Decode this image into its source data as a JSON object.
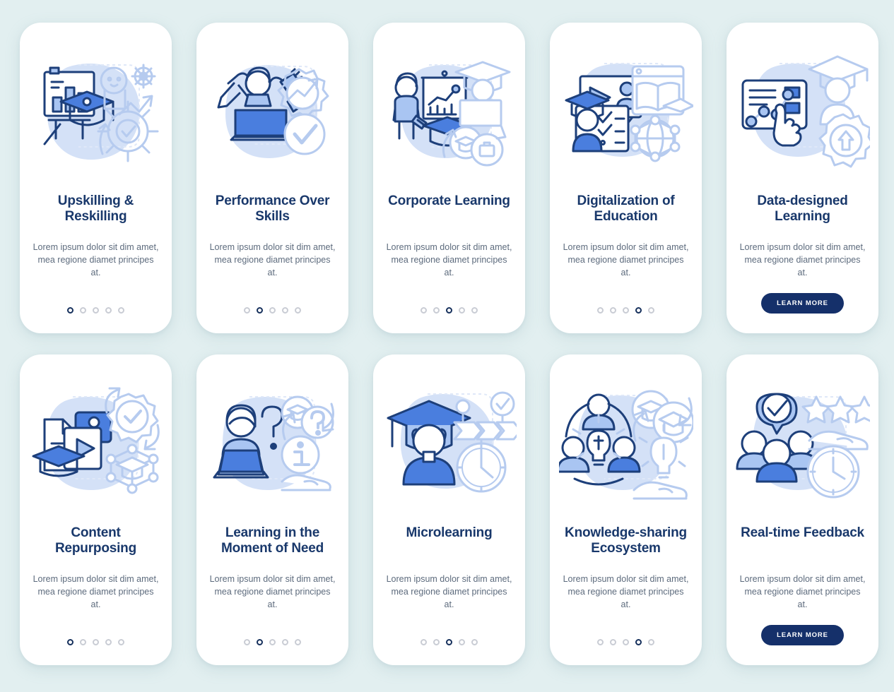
{
  "background_color": "#e2eff0",
  "card_color": "#ffffff",
  "title_color": "#19386b",
  "body_color": "#5d6b7d",
  "accent_color": "#15306a",
  "dot_active_color": "#16305c",
  "dot_inactive_color": "#c9ccd4",
  "shared": {
    "body_text": "Lorem ipsum dolor sit dim amet, mea regione diamet principes at.",
    "learn_more_label": "LEARN MORE",
    "dot_count": 5
  },
  "cards": [
    {
      "title": "Upskilling & Reskilling",
      "body_text": "Lorem ipsum dolor sit dim amet, mea regione diamet principes at.",
      "illustration": "presentation-board-graduation-cap-gear-person-icon",
      "footer_type": "dots",
      "active_dot": 1
    },
    {
      "title": "Performance Over Skills",
      "body_text": "Lorem ipsum dolor sit dim amet, mea regione diamet principes at.",
      "illustration": "multitasking-person-laptop-gear-chart-checkmark-icon",
      "footer_type": "dots",
      "active_dot": 2
    },
    {
      "title": "Corporate Learning",
      "body_text": "Lorem ipsum dolor sit dim amet, mea regione diamet principes at.",
      "illustration": "teacher-pointer-chart-board-graduate-briefcase-icon",
      "footer_type": "dots",
      "active_dot": 3
    },
    {
      "title": "Digitalization of Education",
      "body_text": "Lorem ipsum dolor sit dim amet, mea regione diamet principes at.",
      "illustration": "video-player-checklist-graduate-book-network-icon",
      "footer_type": "dots",
      "active_dot": 4
    },
    {
      "title": "Data-designed Learning",
      "body_text": "Lorem ipsum dolor sit dim amet, mea regione diamet principes at.",
      "illustration": "data-dashboard-hand-pointer-graduate-gear-arrow-icon",
      "footer_type": "button",
      "active_dot": 0
    },
    {
      "title": "Content Repurposing",
      "body_text": "Lorem ipsum dolor sit dim amet, mea regione diamet principes at.",
      "illustration": "documents-video-graduation-cap-gear-check-network-icon",
      "footer_type": "dots",
      "active_dot": 1
    },
    {
      "title": "Learning in the Moment of Need",
      "body_text": "Lorem ipsum dolor sit dim amet, mea regione diamet principes at.",
      "illustration": "person-laptop-question-mark-info-hand-icon",
      "footer_type": "dots",
      "active_dot": 2
    },
    {
      "title": "Microlearning",
      "body_text": "Lorem ipsum dolor sit dim amet, mea regione diamet principes at.",
      "illustration": "graduate-cap-process-arrows-clock-icon",
      "footer_type": "dots",
      "active_dot": 3
    },
    {
      "title": "Knowledge-sharing Ecosystem",
      "body_text": "Lorem ipsum dolor sit dim amet, mea regione diamet principes at.",
      "illustration": "people-lightbulb-graduation-caps-hand-icon",
      "footer_type": "dots",
      "active_dot": 4
    },
    {
      "title": "Real-time Feedback",
      "body_text": "Lorem ipsum dolor sit dim amet, mea regione diamet principes at.",
      "illustration": "people-group-check-bubble-stars-hand-clock-icon",
      "footer_type": "button",
      "active_dot": 0
    }
  ]
}
